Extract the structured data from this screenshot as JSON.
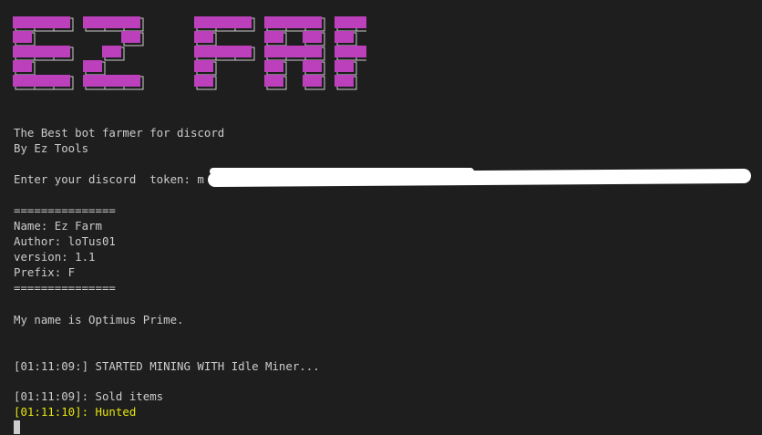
{
  "banner": {
    "text": "EZ FARM",
    "fill_color": "#bc3fbc",
    "shadow_color": "#cccccc"
  },
  "lines": {
    "tagline": "The Best bot farmer for discord",
    "byline": "By Ez Tools",
    "token_prompt": "Enter your discord  token: m",
    "separator_top": "===============",
    "name": "Name: Ez Farm",
    "author": "Author: loTus01",
    "version": "version: 1.1",
    "prefix": "Prefix: F",
    "separator_bottom": "===============",
    "greeting": "My name is Optimus Prime.",
    "log_started": "[01:11:09:] STARTED MINING WITH Idle Miner...",
    "log_sold": "[01:11:09]: Sold items",
    "log_hunted": "[01:11:10]: Hunted"
  },
  "colors": {
    "background": "#1e1e1e",
    "text": "#cccccc",
    "highlight": "#e5e510",
    "banner": "#bc3fbc"
  }
}
